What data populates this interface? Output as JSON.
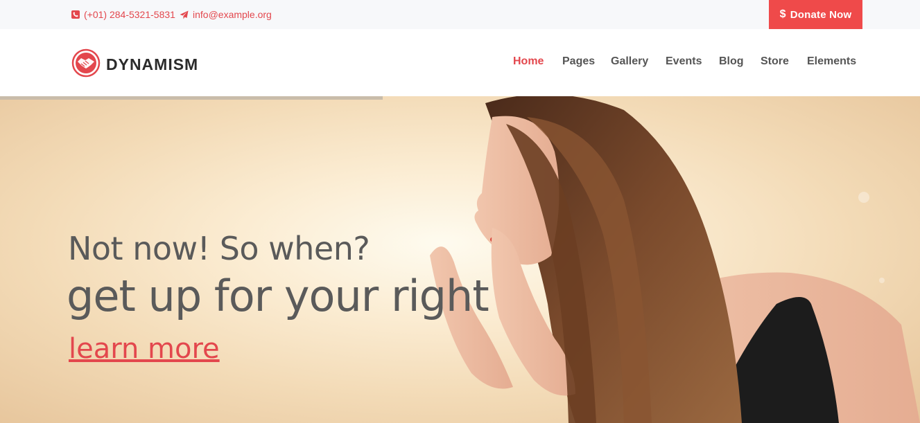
{
  "topbar": {
    "phone": "(+01) 284-5321-5831",
    "email": "info@example.org",
    "donate_label": "Donate Now",
    "donate_icon": "$"
  },
  "header": {
    "logo_text": "DYNAMISM",
    "logo_icon": "handshake-icon",
    "nav": [
      {
        "label": "Home",
        "active": true
      },
      {
        "label": "Pages"
      },
      {
        "label": "Gallery"
      },
      {
        "label": "Events"
      },
      {
        "label": "Blog"
      },
      {
        "label": "Store"
      },
      {
        "label": "Elements"
      }
    ]
  },
  "hero": {
    "line1": "Not now! So when?",
    "line2": "get up for your right",
    "link": "learn more",
    "slider_progress_percent": 41.6
  },
  "colors": {
    "accent": "#e3474d",
    "donate_bg": "#ef4a4a",
    "text": "#5a5a5a"
  }
}
